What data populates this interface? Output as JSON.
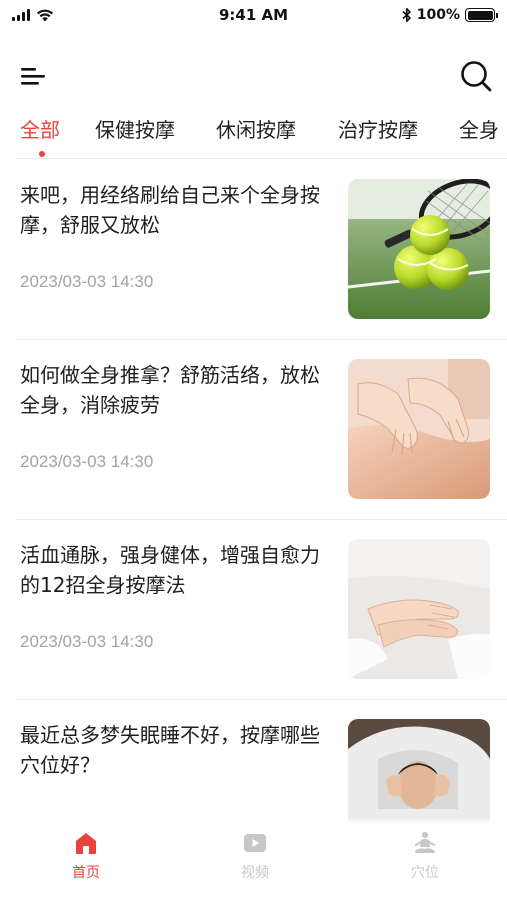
{
  "status_bar": {
    "time": "9:41 AM",
    "battery": "100%"
  },
  "header": {
    "menu_icon": "menu-icon",
    "search_icon": "search-icon"
  },
  "tabs": [
    {
      "label": "全部",
      "active": true
    },
    {
      "label": "保健按摩",
      "active": false
    },
    {
      "label": "休闲按摩",
      "active": false
    },
    {
      "label": "治疗按摩",
      "active": false
    },
    {
      "label": "全身",
      "active": false
    }
  ],
  "articles": [
    {
      "title": "来吧，用经络刷给自己来个全身按摩，舒服又放松",
      "date": "2023/03-03 14:30",
      "image": "tennis-balls-image"
    },
    {
      "title": "如何做全身推拿？舒筋活络，放松全身，消除疲劳",
      "date": "2023/03-03 14:30",
      "image": "back-massage-image"
    },
    {
      "title": "活血通脉，强身健体，增强自愈力的12招全身按摩法",
      "date": "2023/03-03 14:30",
      "image": "hands-image"
    },
    {
      "title": "最近总多梦失眠睡不好，按摩哪些穴位好？",
      "date": "",
      "image": "sleepless-man-image"
    }
  ],
  "bottom_nav": [
    {
      "label": "首页",
      "icon": "home-icon",
      "active": true,
      "color": "#e8443f"
    },
    {
      "label": "视频",
      "icon": "video-icon",
      "active": false,
      "color": "#c7c7c7"
    },
    {
      "label": "穴位",
      "icon": "meditation-icon",
      "active": false,
      "color": "#c7c7c7"
    }
  ],
  "colors": {
    "accent": "#e8443f",
    "muted": "#a3a3a3",
    "divider": "#ececec"
  }
}
